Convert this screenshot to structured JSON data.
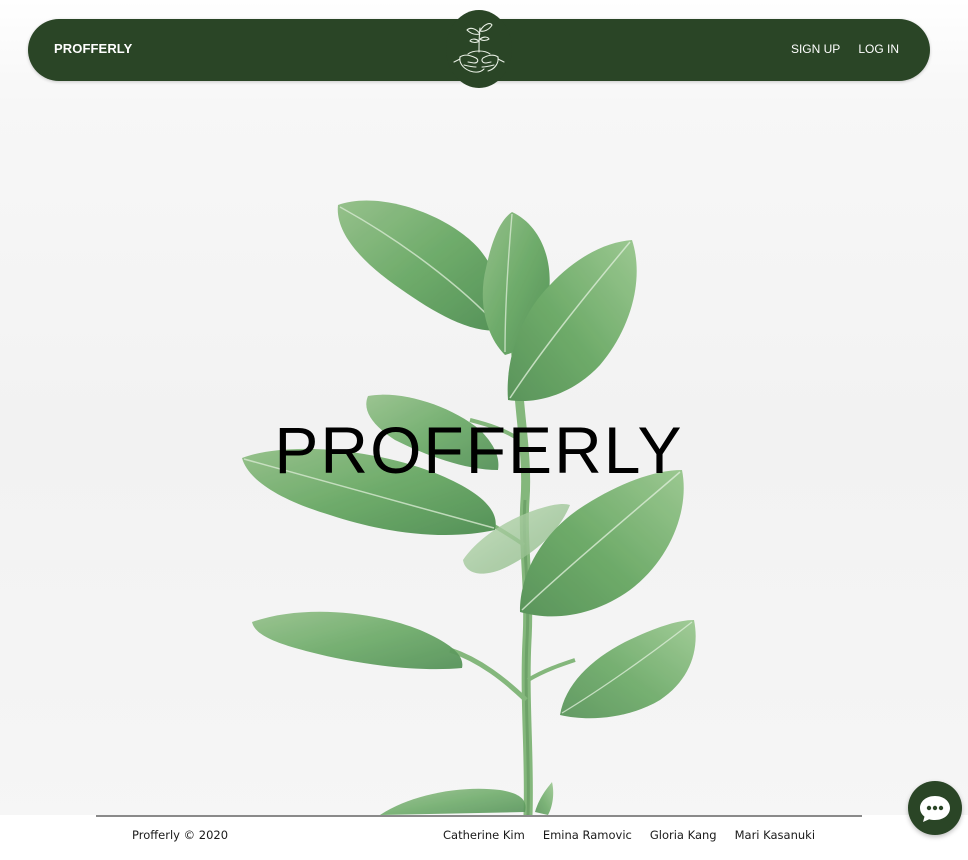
{
  "header": {
    "brand": "PROFFERLY",
    "logo_icon": "plant-in-hands-icon",
    "links": [
      {
        "label": "SIGN UP"
      },
      {
        "label": "LOG IN"
      }
    ]
  },
  "hero": {
    "title": "PROFFERLY",
    "background": "rubber-plant-photo"
  },
  "footer": {
    "copyright": "Profferly © 2020",
    "credits": [
      {
        "name": "Catherine Kim"
      },
      {
        "name": "Emina Ramovic"
      },
      {
        "name": "Gloria Kang"
      },
      {
        "name": "Mari Kasanuki"
      }
    ]
  },
  "chat": {
    "icon": "chat-bubble-icon"
  },
  "colors": {
    "brand_green": "#2a4526",
    "leaf_green": "#3f8c3a",
    "background": "#f4f4f4"
  }
}
